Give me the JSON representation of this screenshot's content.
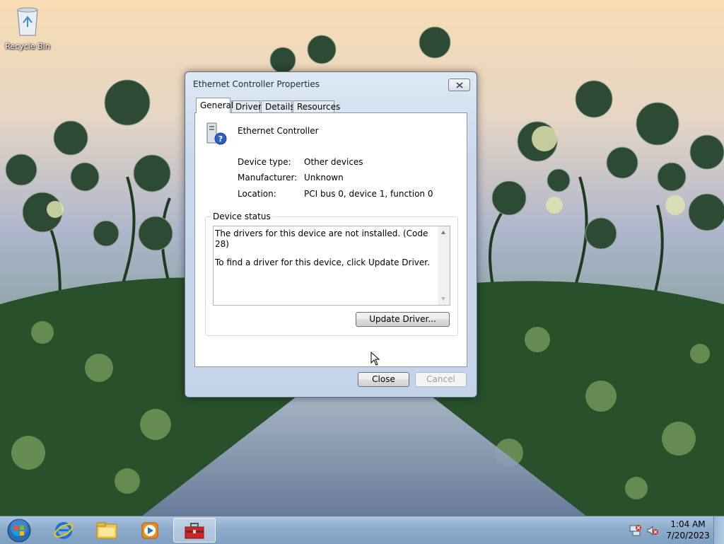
{
  "desktop": {
    "recycle_bin_label": "Recycle Bin"
  },
  "dialog": {
    "title": "Ethernet Controller Properties",
    "tabs": [
      {
        "label": "General",
        "active": true
      },
      {
        "label": "Driver"
      },
      {
        "label": "Details"
      },
      {
        "label": "Resources"
      }
    ],
    "device_name": "Ethernet Controller",
    "device_type_label": "Device type:",
    "device_type_value": "Other devices",
    "manufacturer_label": "Manufacturer:",
    "manufacturer_value": "Unknown",
    "location_label": "Location:",
    "location_value": "PCI bus 0, device 1, function 0",
    "status_group_label": "Device status",
    "status_line1": "The drivers for this device are not installed. (Code 28)",
    "status_line2": "To find a driver for this device, click Update Driver.",
    "update_driver_button": "Update Driver...",
    "close_button": "Close",
    "cancel_button": "Cancel"
  },
  "taskbar": {
    "time": "1:04 AM",
    "date": "7/20/2023"
  },
  "colors": {
    "accent": "#7f9fc1",
    "dialog_frame": "#c3d4ea"
  }
}
